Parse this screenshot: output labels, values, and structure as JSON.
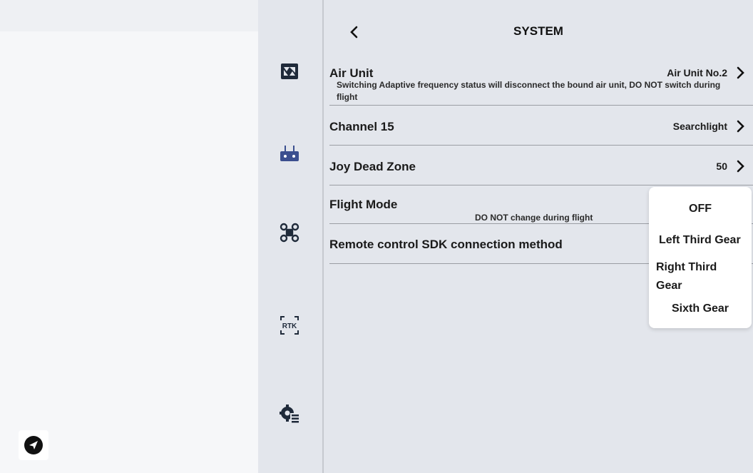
{
  "nav": {
    "items": [
      {
        "id": "camera",
        "icon": "camera-icon"
      },
      {
        "id": "remote",
        "icon": "remote-controller-icon"
      },
      {
        "id": "drone",
        "icon": "drone-icon"
      },
      {
        "id": "rtk",
        "icon": "rtk-icon",
        "label": "RTK"
      },
      {
        "id": "system",
        "icon": "system-settings-icon"
      }
    ]
  },
  "header": {
    "title": "SYSTEM",
    "back_icon": "chevron-left-icon"
  },
  "settings": {
    "air_unit": {
      "label": "Air Unit",
      "value": "Air Unit No.2",
      "note": "Switching Adaptive frequency status will disconnect the bound air unit, DO NOT switch during flight"
    },
    "channel15": {
      "label": "Channel 15",
      "value": "Searchlight"
    },
    "joy_dead_zone": {
      "label": "Joy Dead Zone",
      "value": "50"
    },
    "flight_mode": {
      "label": "Flight Mode",
      "note": "DO NOT change during flight"
    },
    "sdk_connection": {
      "label": "Remote control SDK connection method"
    }
  },
  "dropdown": {
    "options": [
      "OFF",
      "Left Third Gear",
      "Right Third Gear",
      "Sixth Gear"
    ]
  },
  "left_panel": {
    "send_icon": "send-icon"
  }
}
